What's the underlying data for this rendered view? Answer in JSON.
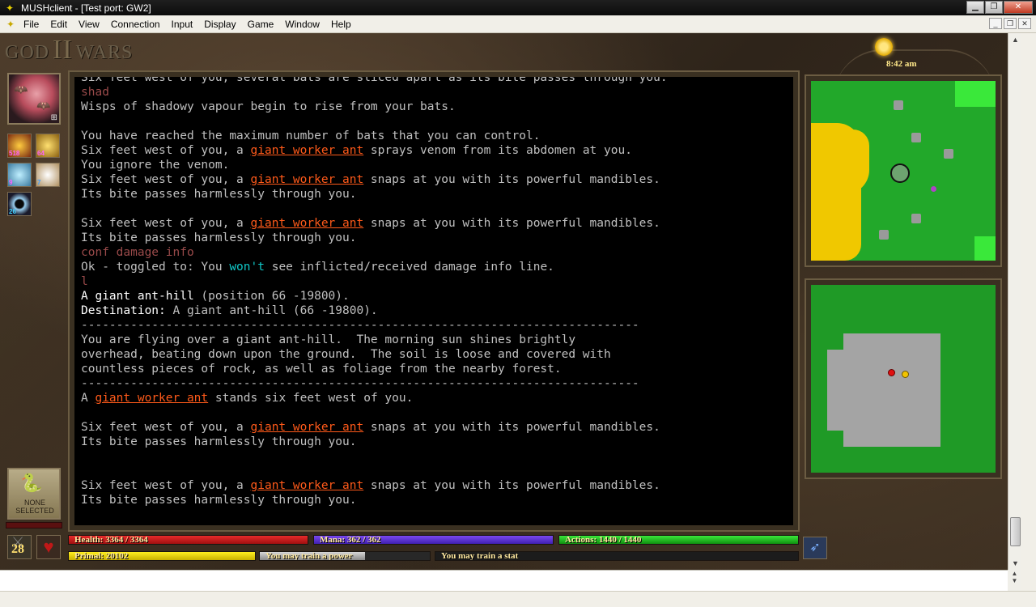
{
  "window": {
    "title": "MUSHclient - [Test port: GW2]",
    "buttons": {
      "minimize": "▁",
      "maximize": "❐",
      "close": "✕"
    }
  },
  "menu": {
    "items": [
      "File",
      "Edit",
      "View",
      "Connection",
      "Input",
      "Display",
      "Game",
      "Window",
      "Help"
    ],
    "mdi": {
      "minimize": "_",
      "restore": "❐",
      "close": "✕"
    }
  },
  "game": {
    "logo": {
      "left": "GOD",
      "roman": "II",
      "right": "WARS"
    },
    "clock": "8:42 am",
    "buffs": [
      "518",
      "64",
      "9",
      "7",
      "26"
    ],
    "target": {
      "label": "NONE SELECTED"
    },
    "level": "28",
    "bars": {
      "health": {
        "label": "Health: 3364 / 3364",
        "fill": 1.0
      },
      "mana": {
        "label": "Mana: 362 / 362",
        "fill": 1.0
      },
      "actions": {
        "label": "Actions: 1440 / 1440",
        "fill": 1.0
      },
      "primal": {
        "label": "Primal: 20102",
        "fill": 1.0
      },
      "power": {
        "label": "You may train a power",
        "fill": 0.62
      },
      "stat": {
        "label": "You may train a stat",
        "fill": 0.0
      }
    }
  },
  "output": [
    {
      "parts": [
        {
          "t": "Six feet west of you, several bats are sliced apart as its bite passes through you.",
          "c": ""
        }
      ],
      "clip": true
    },
    {
      "parts": [
        {
          "t": "shad",
          "c": "cmd"
        }
      ]
    },
    {
      "parts": [
        {
          "t": "Wisps of shadowy vapour begin to rise from your bats.",
          "c": ""
        }
      ]
    },
    {
      "parts": [
        {
          "t": "",
          "c": ""
        }
      ]
    },
    {
      "parts": [
        {
          "t": "You have reached the maximum number of bats that you can control.",
          "c": ""
        }
      ]
    },
    {
      "parts": [
        {
          "t": "Six feet west of you, a ",
          "c": ""
        },
        {
          "t": "giant worker ant",
          "c": "mob"
        },
        {
          "t": " sprays venom from its abdomen at you.",
          "c": ""
        }
      ]
    },
    {
      "parts": [
        {
          "t": "You ignore the venom.",
          "c": ""
        }
      ]
    },
    {
      "parts": [
        {
          "t": "Six feet west of you, a ",
          "c": ""
        },
        {
          "t": "giant worker ant",
          "c": "mob"
        },
        {
          "t": " snaps at you with its powerful mandibles.",
          "c": ""
        }
      ]
    },
    {
      "parts": [
        {
          "t": "Its bite passes harmlessly through you.",
          "c": ""
        }
      ]
    },
    {
      "parts": [
        {
          "t": "",
          "c": ""
        }
      ]
    },
    {
      "parts": [
        {
          "t": "Six feet west of you, a ",
          "c": ""
        },
        {
          "t": "giant worker ant",
          "c": "mob"
        },
        {
          "t": " snaps at you with its powerful mandibles.",
          "c": ""
        }
      ]
    },
    {
      "parts": [
        {
          "t": "Its bite passes harmlessly through you.",
          "c": ""
        }
      ]
    },
    {
      "parts": [
        {
          "t": "conf damage info",
          "c": "cmd"
        }
      ]
    },
    {
      "parts": [
        {
          "t": "Ok - toggled to: You ",
          "c": ""
        },
        {
          "t": "won't",
          "c": "cyan"
        },
        {
          "t": " see inflicted/received damage info line.",
          "c": ""
        }
      ]
    },
    {
      "parts": [
        {
          "t": "l",
          "c": "cmd"
        }
      ]
    },
    {
      "parts": [
        {
          "t": "A giant ant-hill",
          "c": "white"
        },
        {
          "t": " (position 66 -19800).",
          "c": ""
        }
      ]
    },
    {
      "parts": [
        {
          "t": "Destination:",
          "c": "white"
        },
        {
          "t": " A giant ant-hill (66 -19800).",
          "c": ""
        }
      ]
    },
    {
      "parts": [
        {
          "t": "-------------------------------------------------------------------------------",
          "c": ""
        }
      ]
    },
    {
      "parts": [
        {
          "t": "You are flying over a giant ant-hill.  The morning sun shines brightly",
          "c": ""
        }
      ]
    },
    {
      "parts": [
        {
          "t": "overhead, beating down upon the ground.  The soil is loose and covered with",
          "c": ""
        }
      ]
    },
    {
      "parts": [
        {
          "t": "countless pieces of rock, as well as foliage from the nearby forest.",
          "c": ""
        }
      ]
    },
    {
      "parts": [
        {
          "t": "-------------------------------------------------------------------------------",
          "c": ""
        }
      ]
    },
    {
      "parts": [
        {
          "t": "A ",
          "c": ""
        },
        {
          "t": "giant worker ant",
          "c": "mob"
        },
        {
          "t": " stands six feet west of you.",
          "c": ""
        }
      ]
    },
    {
      "parts": [
        {
          "t": "",
          "c": ""
        }
      ]
    },
    {
      "parts": [
        {
          "t": "Six feet west of you, a ",
          "c": ""
        },
        {
          "t": "giant worker ant",
          "c": "mob"
        },
        {
          "t": " snaps at you with its powerful mandibles.",
          "c": ""
        }
      ]
    },
    {
      "parts": [
        {
          "t": "Its bite passes harmlessly through you.",
          "c": ""
        }
      ]
    },
    {
      "parts": [
        {
          "t": "",
          "c": ""
        }
      ]
    },
    {
      "parts": [
        {
          "t": "",
          "c": ""
        }
      ]
    },
    {
      "parts": [
        {
          "t": "Six feet west of you, a ",
          "c": ""
        },
        {
          "t": "giant worker ant",
          "c": "mob"
        },
        {
          "t": " snaps at you with its powerful mandibles.",
          "c": ""
        }
      ]
    },
    {
      "parts": [
        {
          "t": "Its bite passes harmlessly through you.",
          "c": ""
        }
      ]
    }
  ],
  "input": {
    "value": ""
  }
}
